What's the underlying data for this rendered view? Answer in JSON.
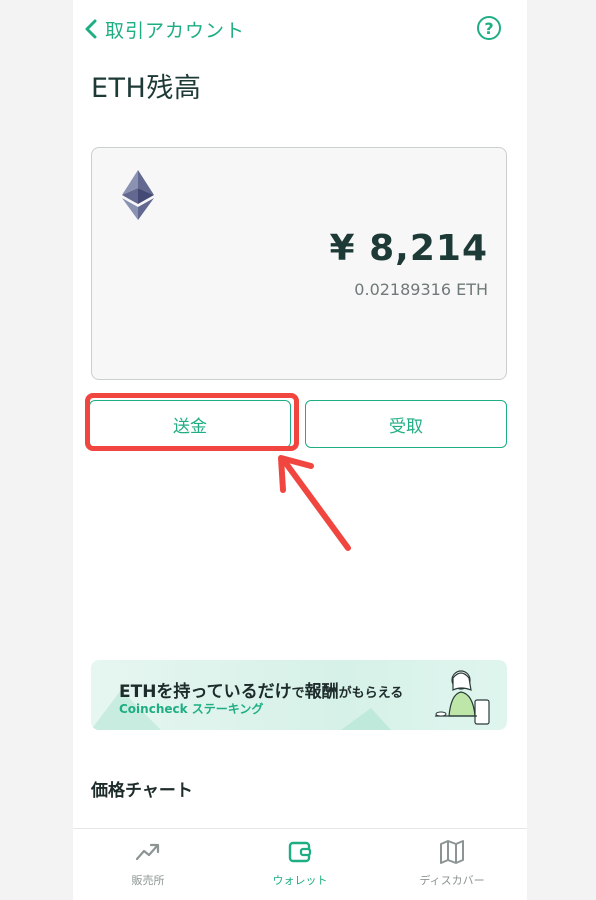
{
  "header": {
    "back_label": "取引アカウント",
    "help_label": "?"
  },
  "page_title": "ETH残高",
  "balance_card": {
    "fiat_value": "¥ 8,214",
    "crypto_value": "0.02189316 ETH",
    "coin_icon": "ethereum-icon"
  },
  "actions": {
    "send_label": "送金",
    "receive_label": "受取"
  },
  "banner": {
    "title_part1": "ETHを持っているだけ",
    "title_part2": "で",
    "title_part3": "報酬",
    "title_part4": "がもらえる",
    "subtitle": "Coincheck ステーキング"
  },
  "price_chart": {
    "title": "価格チャート"
  },
  "tabbar": {
    "items": [
      {
        "label": "販売所",
        "icon": "trend-icon",
        "active": false
      },
      {
        "label": "ウォレット",
        "icon": "wallet-icon",
        "active": true
      },
      {
        "label": "ディスカバー",
        "icon": "map-icon",
        "active": false
      }
    ]
  },
  "colors": {
    "accent": "#1fae83",
    "highlight": "#f0463f",
    "text_dark": "#1d3a36"
  }
}
